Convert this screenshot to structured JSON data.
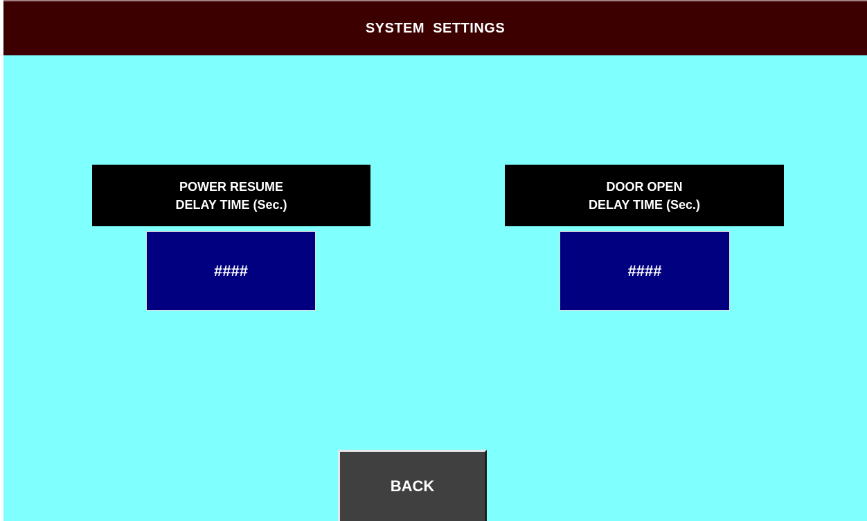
{
  "header": {
    "title": "SYSTEM  SETTINGS"
  },
  "settings": [
    {
      "label_line1": "POWER RESUME",
      "label_line2": "DELAY TIME (Sec.)",
      "value": "####"
    },
    {
      "label_line1": "DOOR OPEN",
      "label_line2": "DELAY TIME (Sec.)",
      "value": "####"
    }
  ],
  "back_button": {
    "label": "BACK"
  },
  "colors": {
    "background": "#80ffff",
    "header": "#3c0000",
    "label_box": "#000000",
    "value_box": "#000080",
    "button": "#404040"
  }
}
